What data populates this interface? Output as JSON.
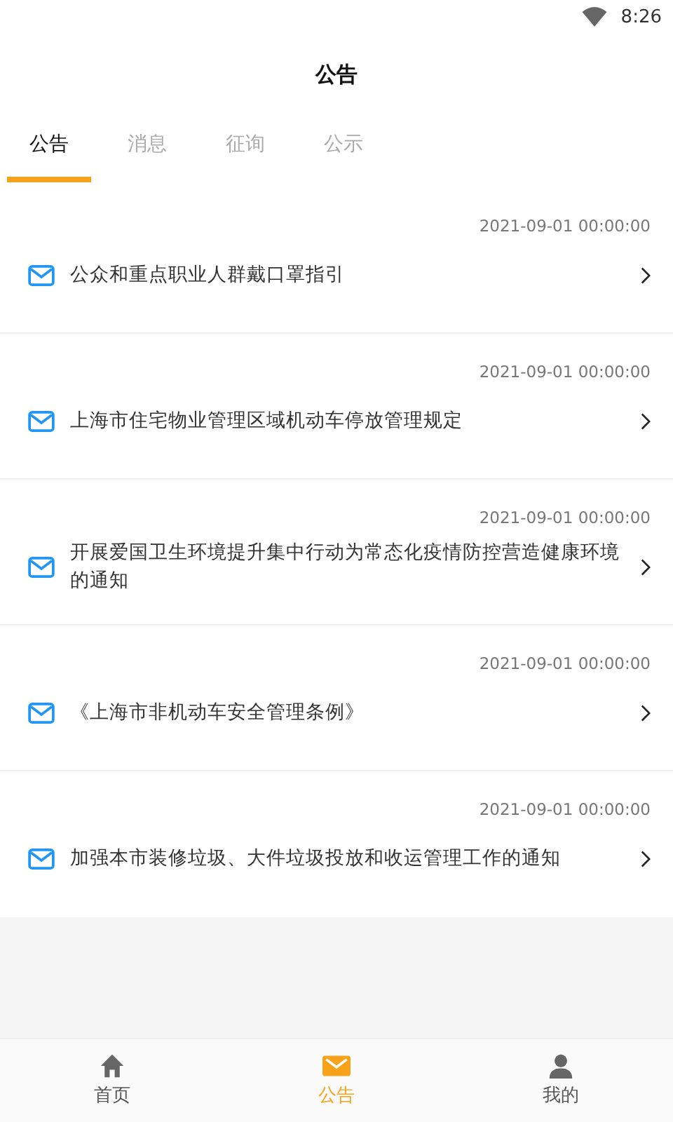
{
  "status_bar": {
    "time": "8:26"
  },
  "title": "公告",
  "tabs": [
    {
      "label": "公告",
      "selected": true
    },
    {
      "label": "消息",
      "selected": false
    },
    {
      "label": "征询",
      "selected": false
    },
    {
      "label": "公示",
      "selected": false
    }
  ],
  "notices": [
    {
      "date": "2021-09-01 00:00:00",
      "title": "公众和重点职业人群戴口罩指引"
    },
    {
      "date": "2021-09-01 00:00:00",
      "title": "上海市住宅物业管理区域机动车停放管理规定"
    },
    {
      "date": "2021-09-01 00:00:00",
      "title": "开展爱国卫生环境提升集中行动为常态化疫情防控营造健康环境的通知"
    },
    {
      "date": "2021-09-01 00:00:00",
      "title": "《上海市非机动车安全管理条例》"
    },
    {
      "date": "2021-09-01 00:00:00",
      "title": "加强本市装修垃圾、大件垃圾投放和收运管理工作的通知"
    }
  ],
  "bottom_nav": [
    {
      "label": "首页",
      "kind": "home",
      "selected": false
    },
    {
      "label": "公告",
      "kind": "mail",
      "selected": true
    },
    {
      "label": "我的",
      "kind": "user",
      "selected": false
    }
  ]
}
